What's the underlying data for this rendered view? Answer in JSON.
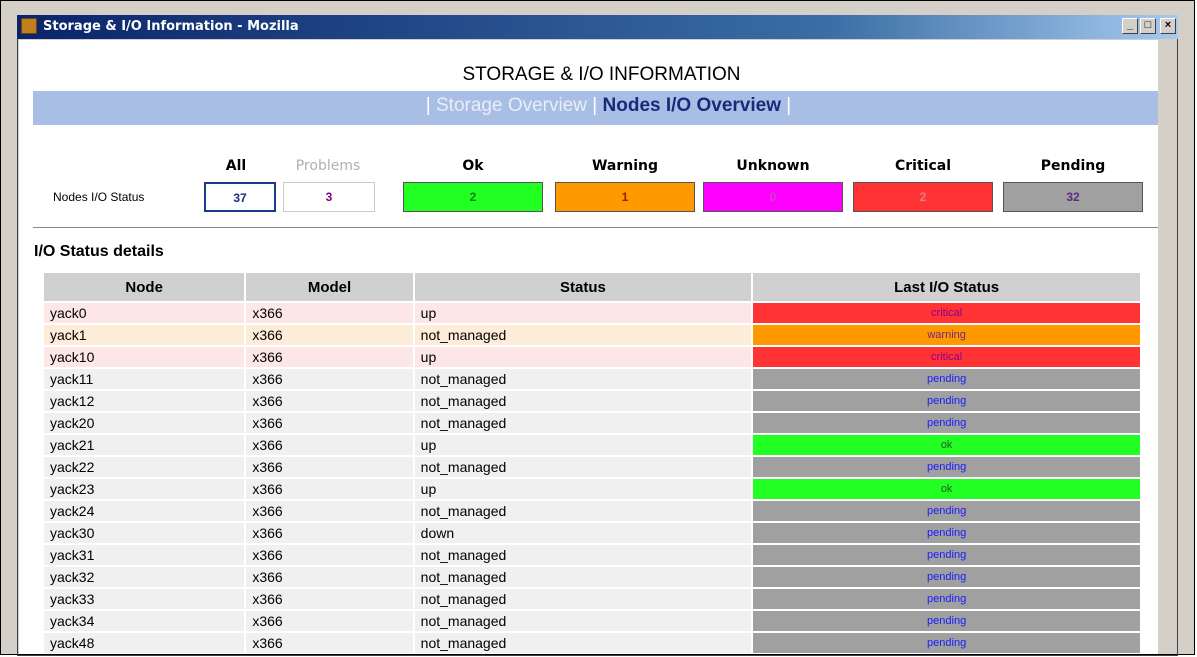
{
  "window": {
    "title": "Storage & I/O Information - Mozilla",
    "controls": [
      "_",
      "□",
      "×"
    ]
  },
  "page": {
    "title": "STORAGE & I/O INFORMATION",
    "nav": {
      "sep": "|",
      "storage_overview": "Storage Overview",
      "nodes_io_overview": "Nodes I/O Overview"
    }
  },
  "summary": {
    "row_label": "Nodes I/O Status",
    "columns": [
      {
        "key": "all",
        "label": "All",
        "value": "37"
      },
      {
        "key": "problems",
        "label": "Problems",
        "value": "3"
      },
      {
        "key": "ok",
        "label": "Ok",
        "value": "2"
      },
      {
        "key": "warning",
        "label": "Warning",
        "value": "1"
      },
      {
        "key": "unknown",
        "label": "Unknown",
        "value": "0"
      },
      {
        "key": "critical",
        "label": "Critical",
        "value": "2"
      },
      {
        "key": "pending",
        "label": "Pending",
        "value": "32"
      }
    ]
  },
  "details": {
    "title": "I/O Status details",
    "headers": [
      "Node",
      "Model",
      "Status",
      "Last I/O Status"
    ],
    "rows": [
      {
        "node": "yack0",
        "model": "x366",
        "status": "up",
        "last": "critical"
      },
      {
        "node": "yack1",
        "model": "x366",
        "status": "not_managed",
        "last": "warning"
      },
      {
        "node": "yack10",
        "model": "x366",
        "status": "up",
        "last": "critical"
      },
      {
        "node": "yack11",
        "model": "x366",
        "status": "not_managed",
        "last": "pending"
      },
      {
        "node": "yack12",
        "model": "x366",
        "status": "not_managed",
        "last": "pending"
      },
      {
        "node": "yack20",
        "model": "x366",
        "status": "not_managed",
        "last": "pending"
      },
      {
        "node": "yack21",
        "model": "x366",
        "status": "up",
        "last": "ok"
      },
      {
        "node": "yack22",
        "model": "x366",
        "status": "not_managed",
        "last": "pending"
      },
      {
        "node": "yack23",
        "model": "x366",
        "status": "up",
        "last": "ok"
      },
      {
        "node": "yack24",
        "model": "x366",
        "status": "not_managed",
        "last": "pending"
      },
      {
        "node": "yack30",
        "model": "x366",
        "status": "down",
        "last": "pending"
      },
      {
        "node": "yack31",
        "model": "x366",
        "status": "not_managed",
        "last": "pending"
      },
      {
        "node": "yack32",
        "model": "x366",
        "status": "not_managed",
        "last": "pending"
      },
      {
        "node": "yack33",
        "model": "x366",
        "status": "not_managed",
        "last": "pending"
      },
      {
        "node": "yack34",
        "model": "x366",
        "status": "not_managed",
        "last": "pending"
      },
      {
        "node": "yack48",
        "model": "x366",
        "status": "not_managed",
        "last": "pending"
      }
    ]
  },
  "colors": {
    "ok": "#22ff22",
    "warning": "#ff9900",
    "unknown": "#ff00ff",
    "critical": "#ff3333",
    "pending": "#a0a0a0",
    "nav_bar": "#a9bee5"
  }
}
